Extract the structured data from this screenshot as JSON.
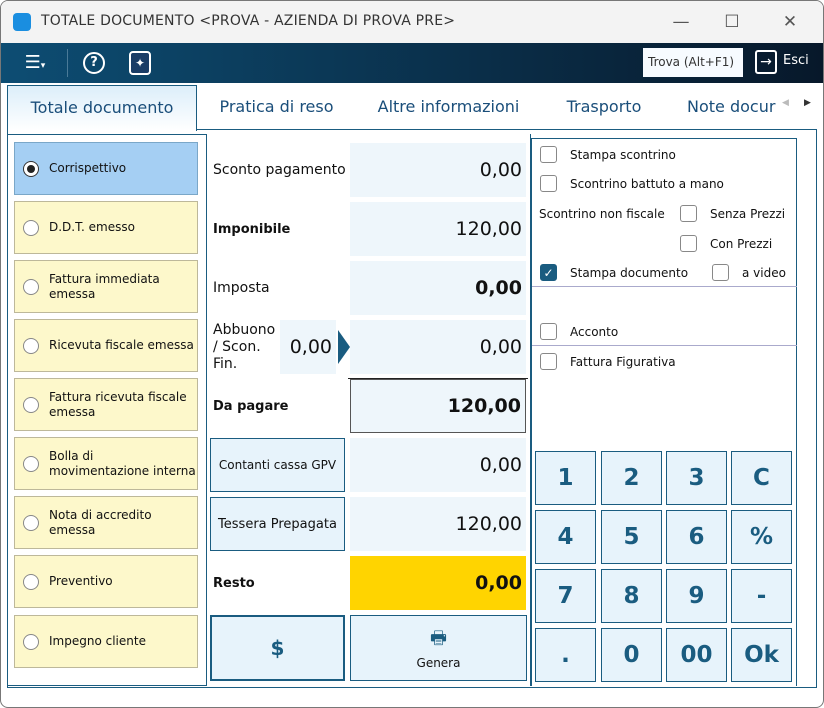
{
  "window": {
    "title": "TOTALE DOCUMENTO <PROVA - AZIENDA DI PROVA PRE>",
    "minimize": "—",
    "maximize": "☐",
    "close": "✕"
  },
  "toolbar": {
    "find": "Trova (Alt+F1)",
    "exit": "Esci"
  },
  "tabs": [
    "Totale documento",
    "Pratica di reso",
    "Altre informazioni",
    "Trasporto",
    "Note docur"
  ],
  "doc_types": [
    "Corrispettivo",
    "D.D.T. emesso",
    "Fattura immediata emessa",
    "Ricevuta fiscale emessa",
    "Fattura ricevuta fiscale emessa",
    "Bolla di movimentazione interna",
    "Nota di accredito emessa",
    "Preventivo",
    "Impegno cliente"
  ],
  "selected_doc": "Corrispettivo",
  "totals": {
    "sconto_pagamento": {
      "label": "Sconto pagamento",
      "value": "0,00"
    },
    "imponibile": {
      "label": "Imponibile",
      "value": "120,00"
    },
    "imposta": {
      "label": "Imposta",
      "value": "0,00"
    },
    "abbuono": {
      "label": "Abbuono / Scon. Fin.",
      "input": "0,00",
      "value": "0,00"
    },
    "da_pagare": {
      "label": "Da pagare",
      "value": "120,00"
    },
    "contanti": {
      "label": "Contanti cassa GPV",
      "value": "0,00"
    },
    "tessera": {
      "label": "Tessera Prepagata",
      "value": "120,00"
    },
    "resto": {
      "label": "Resto",
      "value": "0,00"
    }
  },
  "actions": {
    "currency": "$",
    "generate": "Genera"
  },
  "options": {
    "stampa_scontrino": "Stampa scontrino",
    "scontrino_mano": "Scontrino battuto a mano",
    "scontrino_non_fiscale": "Scontrino non fiscale",
    "senza_prezzi": "Senza Prezzi",
    "con_prezzi": "Con Prezzi",
    "stampa_documento": "Stampa documento",
    "a_video": "a video",
    "acconto": "Acconto",
    "fattura_figurativa": "Fattura Figurativa"
  },
  "keypad": [
    "1",
    "2",
    "3",
    "C",
    "4",
    "5",
    "6",
    "%",
    "7",
    "8",
    "9",
    "-",
    ".",
    "0",
    "00",
    "Ok"
  ],
  "colors": {
    "accent": "#1a5c80",
    "selected": "#a5cff3",
    "doc_bg": "#fdf8cb",
    "resto_bg": "#ffd400"
  }
}
